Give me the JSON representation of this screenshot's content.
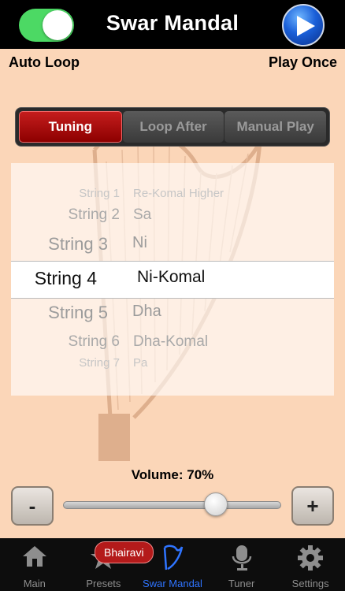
{
  "header": {
    "title": "Swar Mandal",
    "auto_loop_toggle_on": true,
    "auto_loop_label": "Auto Loop",
    "play_once_label": "Play Once"
  },
  "segments": [
    {
      "label": "Tuning",
      "active": true
    },
    {
      "label": "Loop After",
      "active": false
    },
    {
      "label": "Manual Play",
      "active": false
    }
  ],
  "picker": {
    "rows": [
      {
        "key": "String 1",
        "value": "Re-Komal Higher"
      },
      {
        "key": "String 2",
        "value": "Sa"
      },
      {
        "key": "String 3",
        "value": "Ni"
      },
      {
        "key": "String 4",
        "value": "Ni-Komal"
      },
      {
        "key": "String 5",
        "value": "Dha"
      },
      {
        "key": "String 6",
        "value": "Dha-Komal"
      },
      {
        "key": "String 7",
        "value": "Pa"
      }
    ],
    "selected_index": 3
  },
  "volume": {
    "label": "Volume: 70%",
    "value": 0.7,
    "minus_label": "-",
    "plus_label": "+"
  },
  "tabbar": {
    "badge": "Bhairavi",
    "tabs": [
      {
        "label": "Main",
        "icon": "home-icon"
      },
      {
        "label": "Presets",
        "icon": "star-icon"
      },
      {
        "label": "Swar Mandal",
        "icon": "harp-icon",
        "active": true
      },
      {
        "label": "Tuner",
        "icon": "microphone-icon"
      },
      {
        "label": "Settings",
        "icon": "gear-icon"
      }
    ]
  },
  "colors": {
    "background": "#fbd6b8",
    "toggle_on": "#4cd964",
    "active_segment": "#a80e0e",
    "active_tab": "#2f74ff"
  }
}
